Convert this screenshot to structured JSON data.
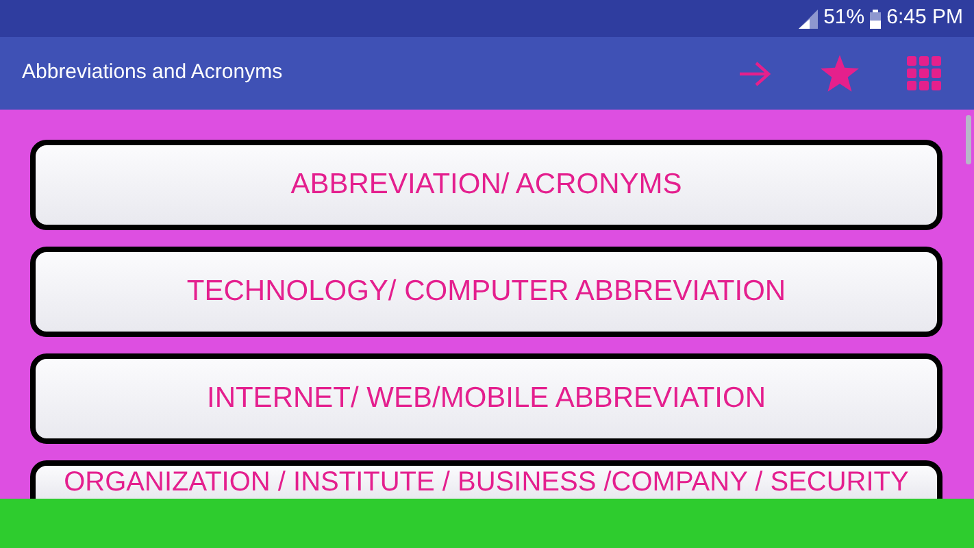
{
  "status_bar": {
    "battery": "51%",
    "time": "6:45 PM"
  },
  "app_bar": {
    "title": "Abbreviations and Acronyms",
    "actions": [
      {
        "kind": "arrow"
      },
      {
        "kind": "star"
      },
      {
        "kind": "grid"
      }
    ]
  },
  "categories": [
    {
      "label": "ABBREVIATION/ ACRONYMS"
    },
    {
      "label": "TECHNOLOGY/ COMPUTER ABBREVIATION"
    },
    {
      "label": "INTERNET/ WEB/MOBILE ABBREVIATION"
    },
    {
      "label": "ORGANIZATION / INSTITUTE / BUSINESS /COMPANY / SECURITY"
    }
  ]
}
